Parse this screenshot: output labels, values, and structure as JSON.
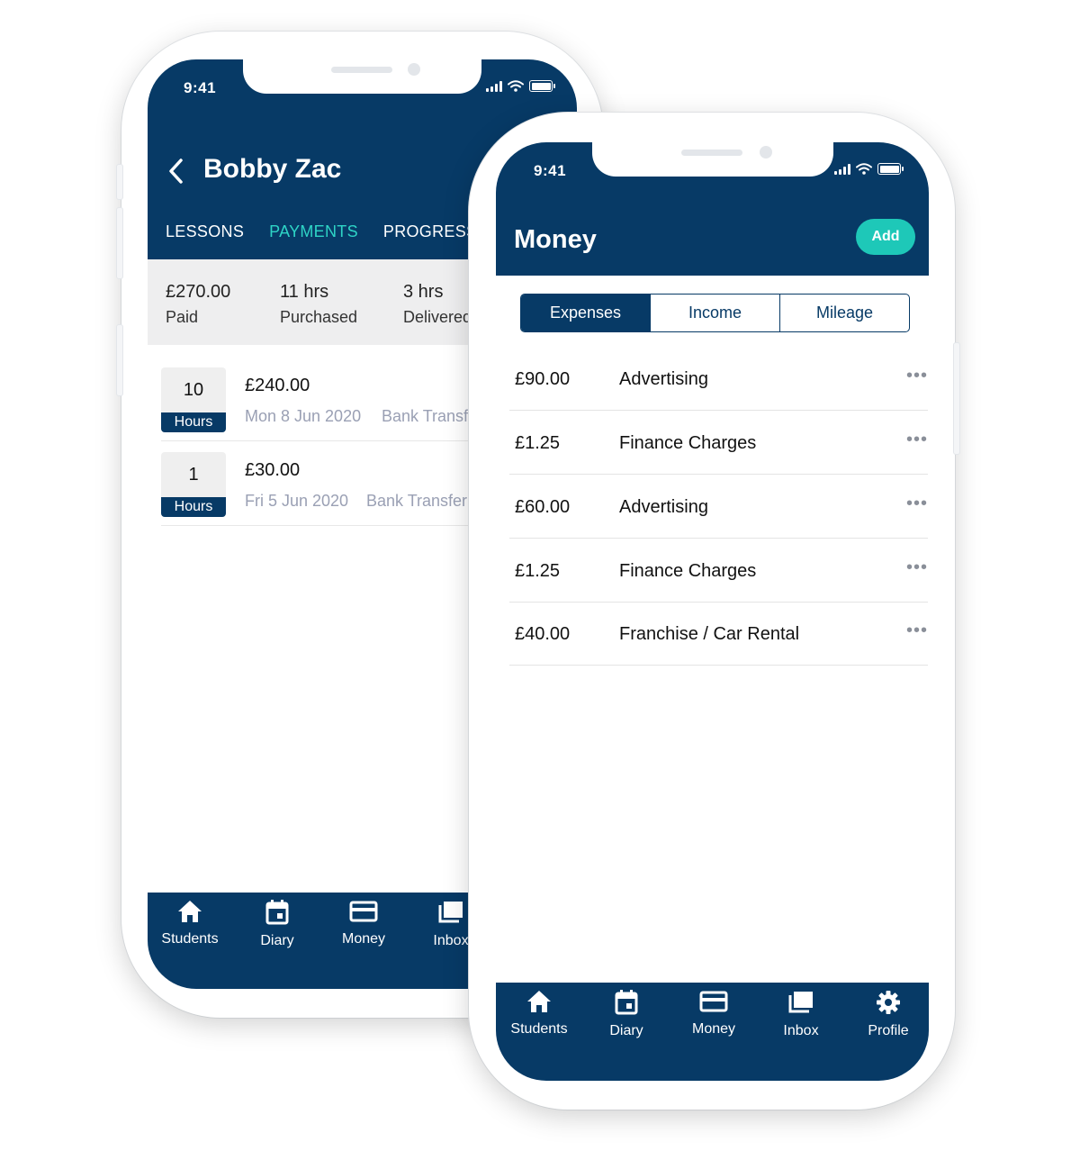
{
  "back_phone": {
    "status": {
      "time": "9:41"
    },
    "header": {
      "back_icon": "chevron-left-icon",
      "title": "Bobby Zac"
    },
    "tabs": [
      {
        "label": "LESSONS",
        "active": false
      },
      {
        "label": "PAYMENTS",
        "active": true
      },
      {
        "label": "PROGRESS",
        "active": false
      }
    ],
    "summary": [
      {
        "value": "£270.00",
        "label": "Paid"
      },
      {
        "value": "11 hrs",
        "label": "Purchased"
      },
      {
        "value": "3 hrs",
        "label": "Delivered"
      }
    ],
    "payments": [
      {
        "hours": "10",
        "hours_label": "Hours",
        "amount": "£240.00",
        "date": "Mon 8 Jun 2020",
        "method": "Bank Transfer"
      },
      {
        "hours": "1",
        "hours_label": "Hours",
        "amount": "£30.00",
        "date": "Fri 5 Jun 2020",
        "method": "Bank Transfer"
      }
    ],
    "nav": [
      {
        "label": "Students",
        "icon": "home-icon"
      },
      {
        "label": "Diary",
        "icon": "calendar-icon"
      },
      {
        "label": "Money",
        "icon": "card-icon"
      },
      {
        "label": "Inbox",
        "icon": "inbox-icon"
      }
    ]
  },
  "front_phone": {
    "status": {
      "time": "9:41"
    },
    "header": {
      "title": "Money",
      "add_label": "Add"
    },
    "segments": [
      {
        "label": "Expenses",
        "active": true
      },
      {
        "label": "Income",
        "active": false
      },
      {
        "label": "Mileage",
        "active": false
      }
    ],
    "expenses": [
      {
        "amount": "£90.00",
        "category": "Advertising",
        "more": "•••"
      },
      {
        "amount": "£1.25",
        "category": "Finance Charges",
        "more": "•••"
      },
      {
        "amount": "£60.00",
        "category": "Advertising",
        "more": "•••"
      },
      {
        "amount": "£1.25",
        "category": "Finance Charges",
        "more": "•••"
      },
      {
        "amount": "£40.00",
        "category": "Franchise / Car Rental",
        "more": "•••"
      }
    ],
    "nav": [
      {
        "label": "Students",
        "icon": "home-icon"
      },
      {
        "label": "Diary",
        "icon": "calendar-icon"
      },
      {
        "label": "Money",
        "icon": "card-icon"
      },
      {
        "label": "Inbox",
        "icon": "inbox-icon"
      },
      {
        "label": "Profile",
        "icon": "gear-icon"
      }
    ]
  },
  "colors": {
    "navy": "#073a66",
    "teal": "#1ec8b8",
    "active_tab": "#2ed4c6",
    "muted_text": "#9aa0b4"
  }
}
